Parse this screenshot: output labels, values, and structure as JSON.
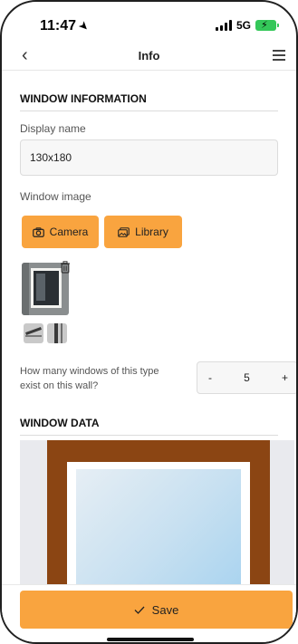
{
  "status_bar": {
    "time": "11:47",
    "network": "5G"
  },
  "nav": {
    "title": "Info"
  },
  "window_information": {
    "header": "WINDOW INFORMATION",
    "display_name_label": "Display name",
    "display_name_value": "130x180",
    "window_image_label": "Window image",
    "camera_label": "Camera",
    "library_label": "Library",
    "count_question": "How many windows of this type exist on this wall?",
    "count_minus": "-",
    "count_value": "5",
    "count_plus": "+"
  },
  "window_data": {
    "header": "WINDOW DATA"
  },
  "footer": {
    "save_label": "Save"
  },
  "colors": {
    "accent": "#f9a43f",
    "frame": "#8b4513",
    "battery": "#34c759"
  }
}
